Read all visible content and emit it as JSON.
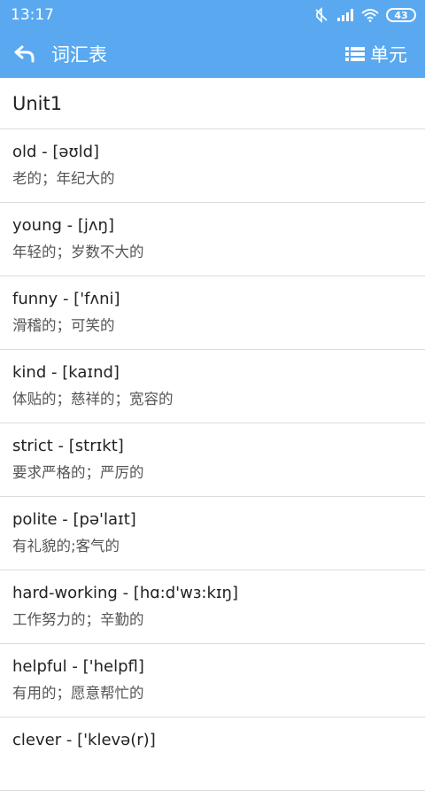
{
  "status_bar": {
    "time": "13:17",
    "battery": "43"
  },
  "toolbar": {
    "title": "词汇表",
    "unit_label": "单元"
  },
  "unit": {
    "title": "Unit1"
  },
  "words": [
    {
      "word": "old",
      "separator": " - ",
      "phonetic": "[əʊld]",
      "meaning": "老的；年纪大的"
    },
    {
      "word": "young",
      "separator": " - ",
      "phonetic": "[jʌŋ]",
      "meaning": "年轻的；岁数不大的"
    },
    {
      "word": "funny",
      "separator": " - ",
      "phonetic": "['fʌni]",
      "meaning": "滑稽的；可笑的"
    },
    {
      "word": "kind",
      "separator": " - ",
      "phonetic": "[kaɪnd]",
      "meaning": "体贴的；慈祥的；宽容的"
    },
    {
      "word": "strict",
      "separator": " - ",
      "phonetic": "[strɪkt]",
      "meaning": "要求严格的；严厉的"
    },
    {
      "word": "polite",
      "separator": " - ",
      "phonetic": "[pə'laɪt]",
      "meaning": "有礼貌的;客气的"
    },
    {
      "word": "hard-working",
      "separator": " - ",
      "phonetic": "[hɑ:d'wɜ:kɪŋ]",
      "meaning": "工作努力的；辛勤的"
    },
    {
      "word": "helpful",
      "separator": " - ",
      "phonetic": "['helpfl]",
      "meaning": "有用的；愿意帮忙的"
    },
    {
      "word": "clever",
      "separator": " - ",
      "phonetic": "['klevə(r)]",
      "meaning": ""
    }
  ],
  "colors": {
    "accent": "#5aa9f0",
    "divider": "#dcdcdc"
  },
  "icons": {
    "back": "back-arrow-icon",
    "list": "list-icon",
    "mute": "mute-icon",
    "signal": "signal-icon",
    "wifi": "wifi-icon",
    "battery": "battery-icon"
  }
}
